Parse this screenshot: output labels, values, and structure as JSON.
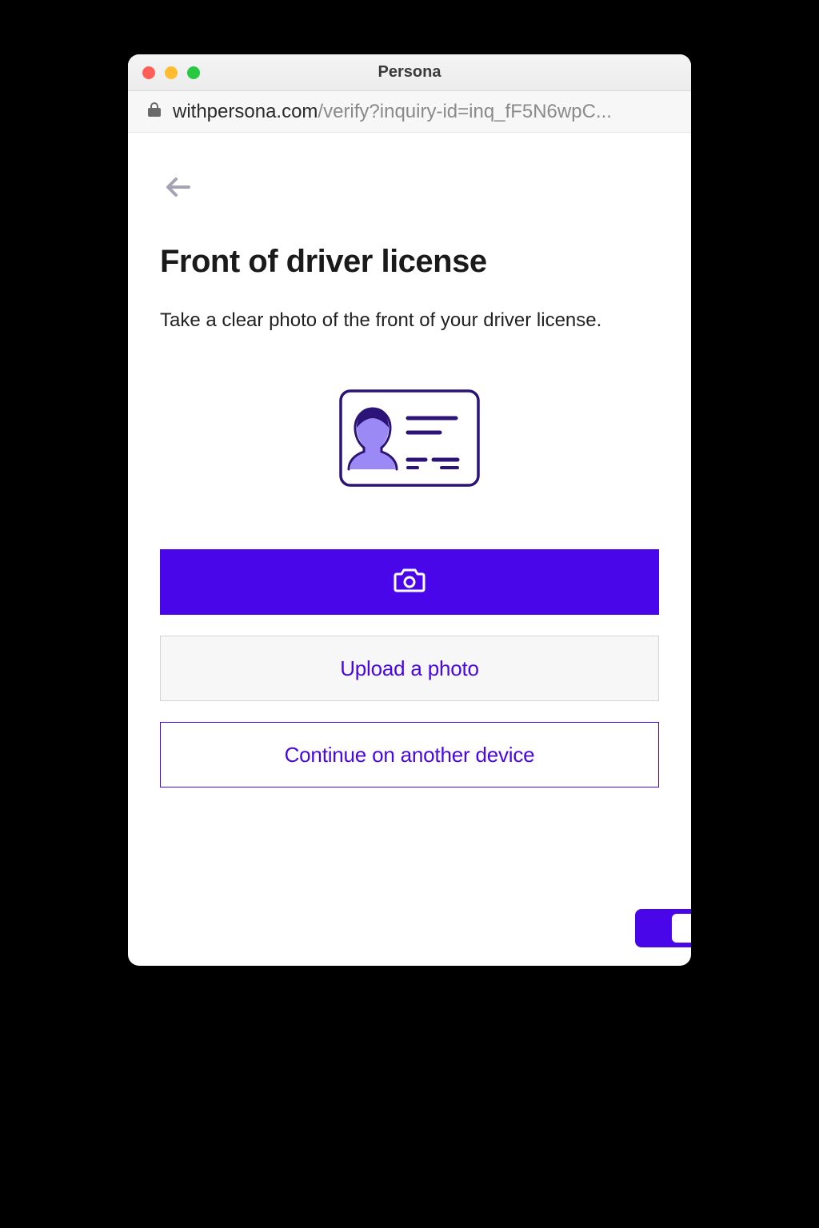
{
  "window": {
    "title": "Persona"
  },
  "url": {
    "domain": "withpersona.com",
    "path": "/verify?inquiry-id=inq_fF5N6wpC..."
  },
  "page": {
    "title": "Front of driver license",
    "subtitle": "Take a clear photo of the front of your driver license."
  },
  "buttons": {
    "upload": "Upload a photo",
    "continue": "Continue on another device"
  },
  "colors": {
    "accent": "#4907e9"
  }
}
